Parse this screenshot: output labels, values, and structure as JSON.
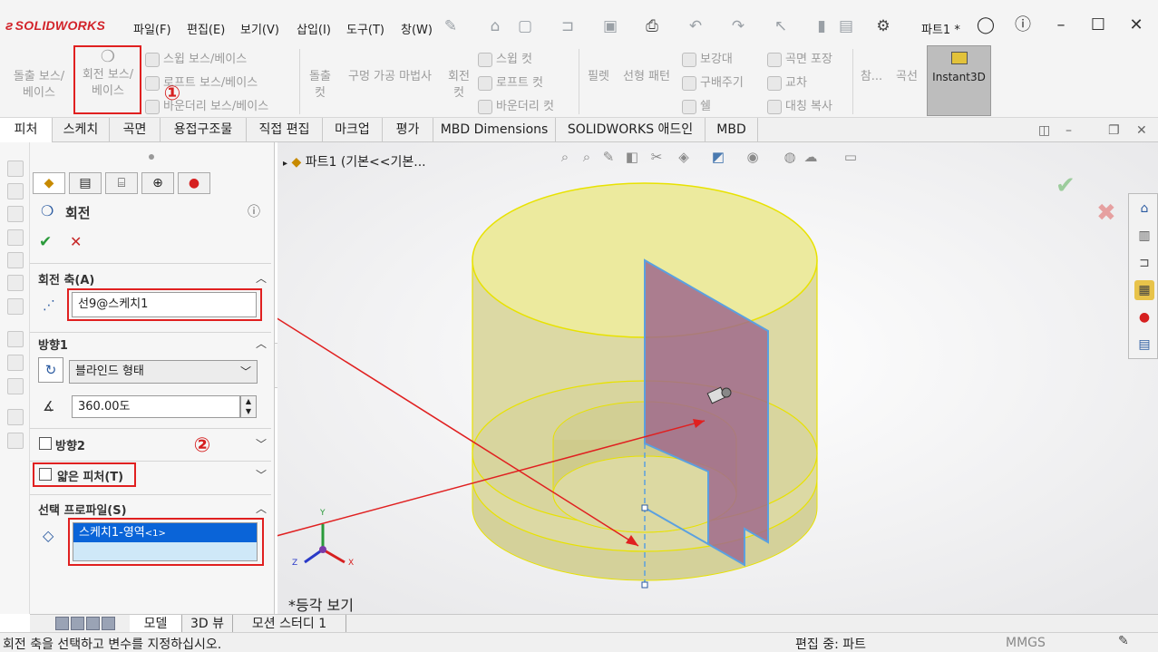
{
  "app": {
    "logo": "SOLIDWORKS",
    "document_title": "파트1 *",
    "menu": [
      "파일(F)",
      "편집(E)",
      "보기(V)",
      "삽입(I)",
      "도구(T)",
      "창(W)"
    ]
  },
  "command_manager": {
    "extrude_boss": "돌출 보스/\n베이스",
    "revolve_boss": "회전 보스/\n베이스",
    "sweep_boss": "스윕 보스/베이스",
    "loft_boss": "로프트 보스/베이스",
    "boundary_boss": "바운더리 보스/베이스",
    "extrude_cut": "돌출\n컷",
    "hole_wizard": "구멍 가공 마법사",
    "revolve_cut": "회전\n컷",
    "sweep_cut": "스윕 컷",
    "loft_cut": "로프트 컷",
    "boundary_cut": "바운더리 컷",
    "fillet": "필렛",
    "linear_pattern": "선형 패턴",
    "rib": "보강대",
    "draft": "구배주기",
    "shell": "쉘",
    "wrap": "곡면 포장",
    "intersect": "교차",
    "mirror": "대칭 복사",
    "reference": "참...",
    "curves": "곡선",
    "instant3d": "Instant3D",
    "annotation_1": "①",
    "annotation_2": "②"
  },
  "tabs": [
    "피처",
    "스케치",
    "곡면",
    "용접구조물",
    "직접 편집",
    "마크업",
    "평가",
    "MBD Dimensions",
    "SOLIDWORKS 애드인",
    "MBD"
  ],
  "property_manager": {
    "title": "회전",
    "axis_section": "회전 축(A)",
    "axis_value": "선9@스케치1",
    "direction1_section": "방향1",
    "end_condition": "블라인드 형태",
    "angle_value": "360.00도",
    "direction2_label": "방향2",
    "thin_feature_label": "얇은 피처(T)",
    "profile_section": "선택 프로파일(S)",
    "profile_value": "스케치1-영역",
    "profile_suffix": "<1>"
  },
  "graphics": {
    "tree_root": "파트1  (기본<<기본...",
    "view_label": "*등각 보기",
    "axis_x": "X",
    "axis_y": "Y",
    "axis_z": "Z"
  },
  "bottom_tabs": [
    "모델",
    "3D 뷰",
    "모션 스터디 1"
  ],
  "status": {
    "message": "회전 축을 선택하고 변수를 지정하십시오.",
    "mode": "편집 중: 파트",
    "units": "MMGS"
  },
  "colors": {
    "accent_red": "#e02020",
    "solid_yellow": "#ece9a6",
    "profile_plane": "#a06a8c",
    "selection_blue": "#0a64d8"
  }
}
